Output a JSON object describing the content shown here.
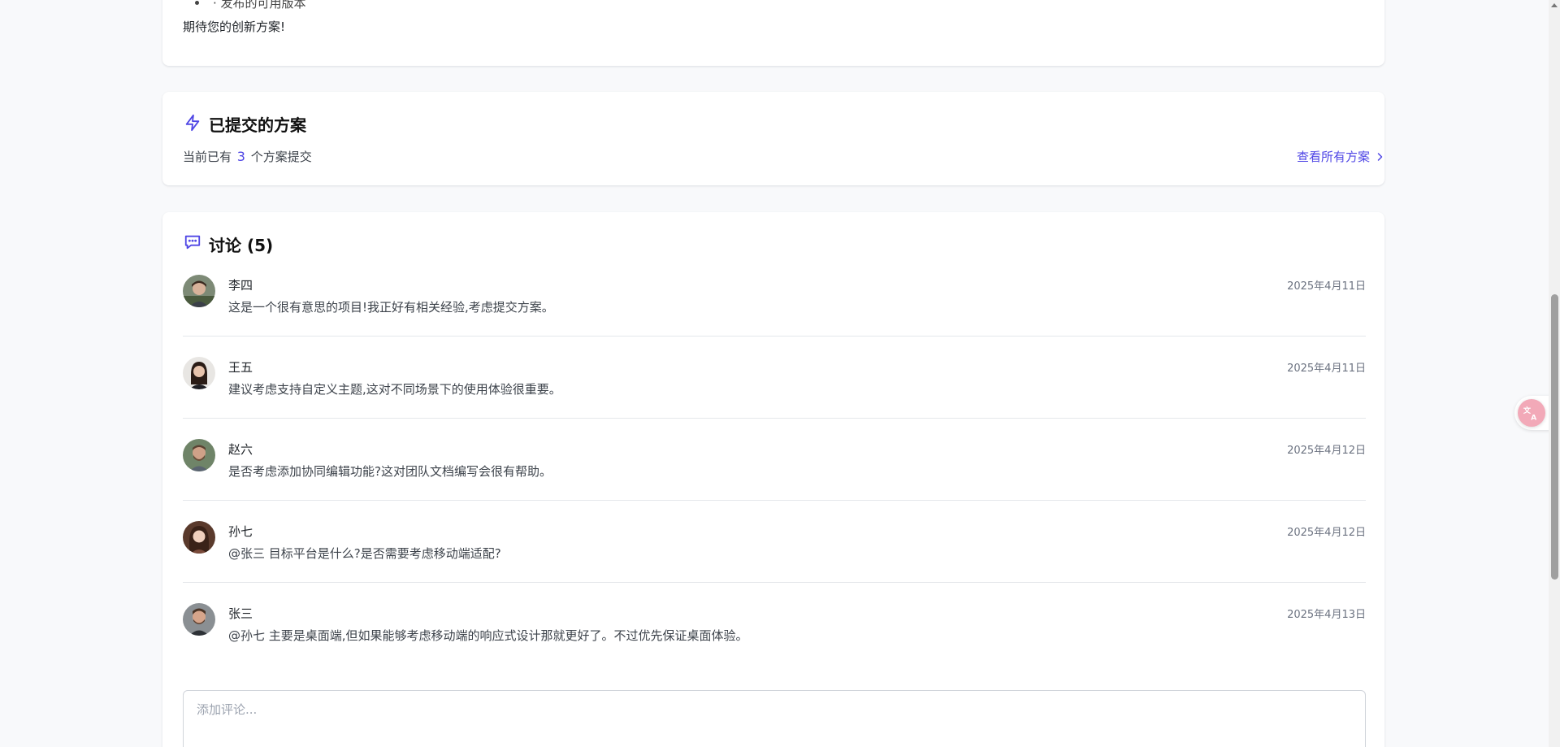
{
  "description": {
    "bullet_fragment": "· 发布的可用版本",
    "closing": "期待您的创新方案!"
  },
  "proposals": {
    "title": "已提交的方案",
    "count_prefix": "当前已有",
    "count": "3",
    "count_suffix": "个方案提交",
    "view_all_label": "查看所有方案"
  },
  "discussion": {
    "title": "讨论 (5)",
    "comments": [
      {
        "author": "李四",
        "date": "2025年4月11日",
        "text": "这是一个很有意思的项目!我正好有相关经验,考虑提交方案。"
      },
      {
        "author": "王五",
        "date": "2025年4月11日",
        "text": "建议考虑支持自定义主题,这对不同场景下的使用体验很重要。"
      },
      {
        "author": "赵六",
        "date": "2025年4月12日",
        "text": "是否考虑添加协同编辑功能?这对团队文档编写会很有帮助。"
      },
      {
        "author": "孙七",
        "date": "2025年4月12日",
        "text": "@张三 目标平台是什么?是否需要考虑移动端适配?"
      },
      {
        "author": "张三",
        "date": "2025年4月13日",
        "text": "@孙七 主要是桌面端,但如果能够考虑移动端的响应式设计那就更好了。不过优先保证桌面体验。"
      }
    ],
    "input_placeholder": "添加评论..."
  },
  "colors": {
    "accent": "#4f46e5",
    "background": "#f8f9fb",
    "card": "#ffffff",
    "divider": "#e5e7eb",
    "translate_button": "#f2a9b8"
  },
  "icons": {
    "proposals_icon": "lightning-icon",
    "discussion_icon": "chat-bubble-icon",
    "view_all_icon": "chevron-right-icon",
    "translate_icon": "translate-icon"
  }
}
